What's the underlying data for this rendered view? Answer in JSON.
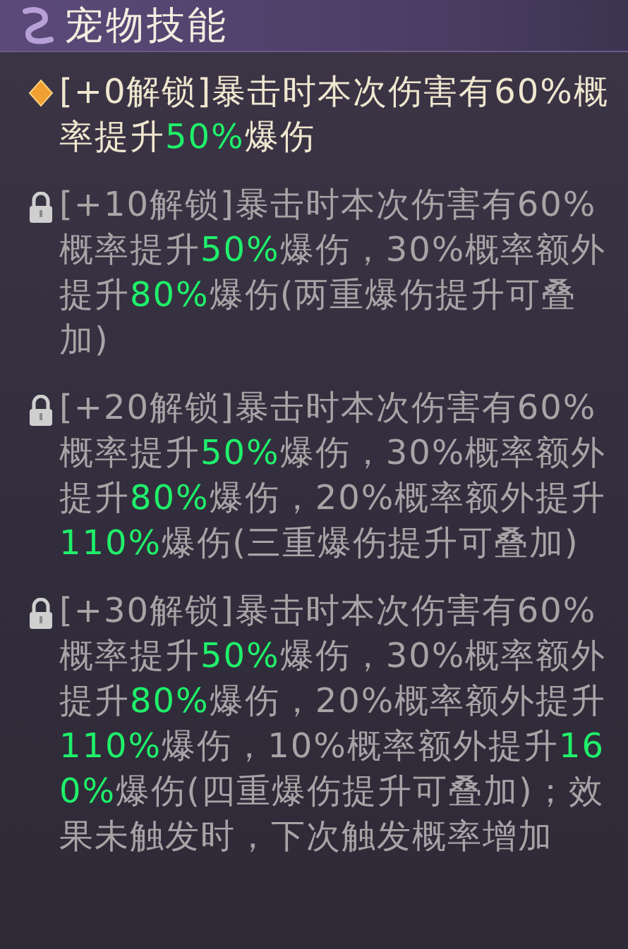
{
  "title": "宠物技能",
  "skills": [
    {
      "locked": false,
      "parts": [
        {
          "text": "[+0解锁]暴击时本次伤害有60%概率提升",
          "highlight": false
        },
        {
          "text": "50%",
          "highlight": true
        },
        {
          "text": "爆伤",
          "highlight": false
        }
      ]
    },
    {
      "locked": true,
      "parts": [
        {
          "text": "[+10解锁]暴击时本次伤害有60%概率提升",
          "highlight": false
        },
        {
          "text": "50%",
          "highlight": true
        },
        {
          "text": "爆伤，30%概率额外提升",
          "highlight": false
        },
        {
          "text": "80%",
          "highlight": true
        },
        {
          "text": "爆伤(两重爆伤提升可叠加)",
          "highlight": false
        }
      ]
    },
    {
      "locked": true,
      "parts": [
        {
          "text": "[+20解锁]暴击时本次伤害有60%概率提升",
          "highlight": false
        },
        {
          "text": "50%",
          "highlight": true
        },
        {
          "text": "爆伤，30%概率额外提升",
          "highlight": false
        },
        {
          "text": "80%",
          "highlight": true
        },
        {
          "text": "爆伤，20%概率额外提升",
          "highlight": false
        },
        {
          "text": "110%",
          "highlight": true
        },
        {
          "text": "爆伤(三重爆伤提升可叠加)",
          "highlight": false
        }
      ]
    },
    {
      "locked": true,
      "parts": [
        {
          "text": "[+30解锁]暴击时本次伤害有60%概率提升",
          "highlight": false
        },
        {
          "text": "50%",
          "highlight": true
        },
        {
          "text": "爆伤，30%概率额外提升",
          "highlight": false
        },
        {
          "text": "80%",
          "highlight": true
        },
        {
          "text": "爆伤，20%概率额外提升",
          "highlight": false
        },
        {
          "text": "110%",
          "highlight": true
        },
        {
          "text": "爆伤，10%概率额外提升",
          "highlight": false
        },
        {
          "text": "160%",
          "highlight": true
        },
        {
          "text": "爆伤(四重爆伤提升可叠加)；效果未触发时，下次触发概率增加",
          "highlight": false
        }
      ]
    }
  ]
}
